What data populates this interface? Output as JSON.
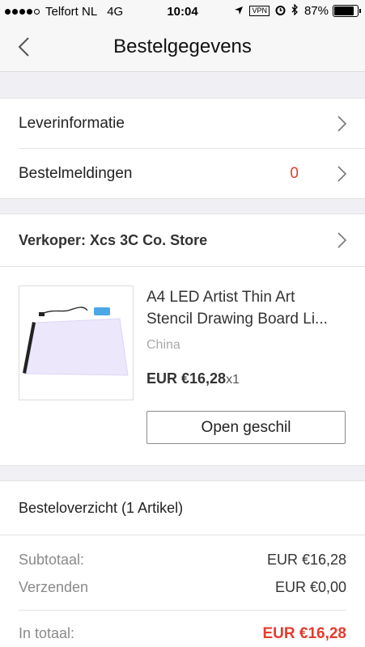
{
  "status_bar": {
    "carrier": "Telfort NL",
    "network": "4G",
    "time": "10:04",
    "vpn": "VPN",
    "battery": "87%",
    "battery_level": 0.87,
    "icons": [
      "location-arrow-icon",
      "alarm-icon",
      "bluetooth-icon"
    ]
  },
  "header": {
    "title": "Bestelgegevens",
    "back_icon": "chevron-left-icon"
  },
  "info_rows": [
    {
      "label": "Leverinformatie"
    },
    {
      "label": "Bestelmeldingen",
      "count": "0"
    }
  ],
  "seller": {
    "label": "Verkoper: Xcs 3C Co. Store"
  },
  "product": {
    "title_line1": "A4 LED Artist Thin Art",
    "title_line2": "Stencil Drawing Board Li...",
    "origin": "China",
    "price": "EUR €16,28",
    "quantity": "x1",
    "dispute_button": "Open geschil"
  },
  "overview": {
    "title": "Besteloverzicht (1 Artikel)",
    "subtotal_label": "Subtotaal:",
    "subtotal_value": "EUR €16,28",
    "shipping_label": "Verzenden",
    "shipping_value": "EUR €0,00",
    "total_label": "In totaal:",
    "total_value": "EUR €16,28"
  },
  "colors": {
    "accent_red": "#e53b2c",
    "background_gap": "#efeff4",
    "navbar": "#f7f7f7"
  }
}
